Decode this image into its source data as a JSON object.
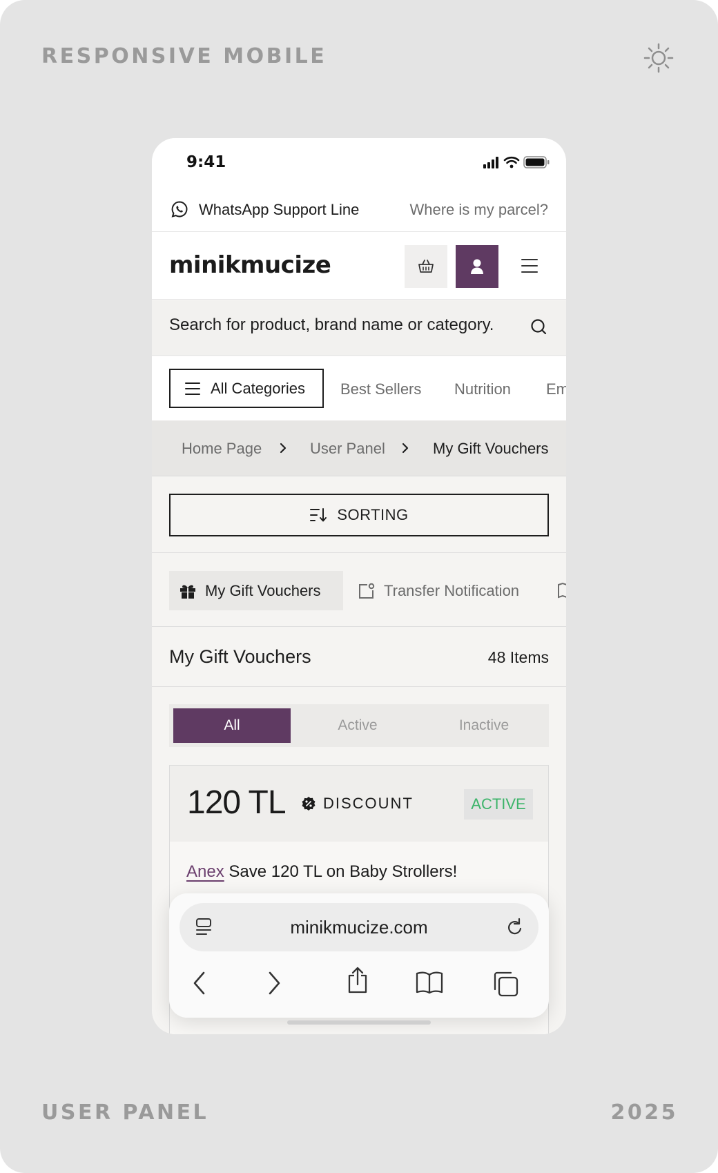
{
  "frame": {
    "top_left_label": "RESPONSIVE MOBILE",
    "bottom_left_label": "USER PANEL",
    "bottom_right_label": "2025",
    "theme_icon": "sun-icon"
  },
  "status_bar": {
    "time": "9:41",
    "icons": [
      "signal-icon",
      "wifi-icon",
      "battery-icon"
    ]
  },
  "top_bar": {
    "support_label": "WhatsApp Support Line",
    "parcel_link": "Where is my parcel?"
  },
  "header": {
    "logo": "minikmucize",
    "buttons": [
      "basket-icon",
      "user-icon",
      "menu-icon"
    ]
  },
  "search": {
    "placeholder": "Search for product, brand name or category."
  },
  "categories": {
    "all_label": "All Categories",
    "links": [
      "Best Sellers",
      "Nutrition",
      "Em"
    ]
  },
  "breadcrumb": [
    "Home Page",
    "User Panel",
    "My Gift Vouchers"
  ],
  "sorting": {
    "label": "SORTING"
  },
  "panel_tabs": {
    "active": "My Gift Vouchers",
    "other": "Transfer Notification"
  },
  "section": {
    "title": "My Gift Vouchers",
    "count": "48 Items"
  },
  "filter": {
    "options": [
      "All",
      "Active",
      "Inactive"
    ],
    "selected": "All"
  },
  "voucher": {
    "amount": "120 TL",
    "type": "DISCOUNT",
    "status": "ACTIVE",
    "brand": "Anex",
    "description": "Save 120 TL on Baby Strollers!"
  },
  "browser": {
    "url": "minikmucize.com"
  },
  "colors": {
    "brand_purple": "#5f3a62",
    "active_green": "#3cb46a",
    "frame_bg": "#e4e4e4"
  }
}
